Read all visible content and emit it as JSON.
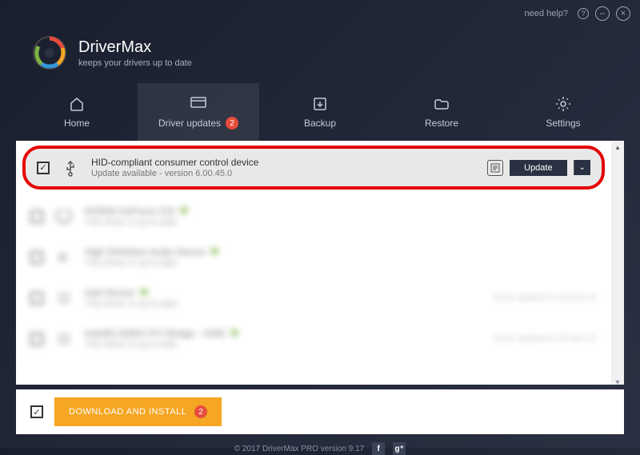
{
  "titlebar": {
    "help_label": "need help?"
  },
  "brand": {
    "title": "DriverMax",
    "tagline": "keeps your drivers up to date"
  },
  "nav": {
    "home": "Home",
    "updates": "Driver updates",
    "updates_badge": "2",
    "backup": "Backup",
    "restore": "Restore",
    "settings": "Settings"
  },
  "highlighted": {
    "name": "HID-compliant consumer control device",
    "sub": "Update available - version 6.00.45.0",
    "update_btn": "Update"
  },
  "rows": [
    {
      "name": "NVIDIA GeForce 210",
      "sub": "This driver is up-to-date",
      "meta": ""
    },
    {
      "name": "High Definition Audio Device",
      "sub": "This driver is up-to-date",
      "meta": ""
    },
    {
      "name": "Intel Device",
      "sub": "This driver is up-to-date",
      "meta": "Driver updated on 03-Nov-16"
    },
    {
      "name": "Intel(R) 82801 PCI Bridge - 244E",
      "sub": "This driver is up-to-date",
      "meta": "Driver updated on 03-Nov-16"
    }
  ],
  "footer": {
    "download_btn": "DOWNLOAD AND INSTALL",
    "download_badge": "2"
  },
  "bottom": {
    "copyright": "© 2017 DriverMax PRO version 9.17"
  }
}
